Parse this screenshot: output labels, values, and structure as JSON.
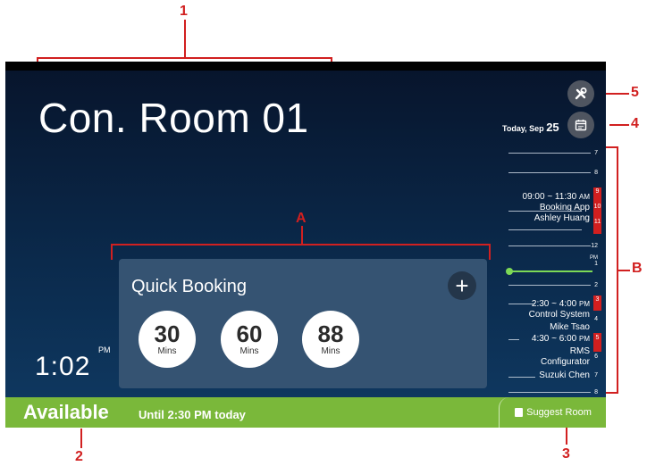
{
  "room": {
    "title": "Con. Room 01"
  },
  "date": {
    "prefix": "Today, Sep",
    "day": "25"
  },
  "timeline": {
    "hours": [
      "7",
      "8",
      "9",
      "10",
      "11",
      "12",
      "1",
      "2",
      "3",
      "4",
      "5",
      "6",
      "7",
      "8"
    ],
    "pm_marker": "PM",
    "booking_1": {
      "time": "09:00 ~ 11:30",
      "ampm": "AM",
      "title": "Booking App",
      "host": "Ashley Huang"
    },
    "booking_2": {
      "time": "2:30 ~ 4:00",
      "ampm": "PM",
      "title": "Control System",
      "host": "Mike Tsao"
    },
    "booking_3": {
      "time": "4:30 ~ 6:00",
      "ampm": "PM",
      "title": "RMS Configurator",
      "host": "Suzuki Chen"
    }
  },
  "quick_booking": {
    "title": "Quick Booking",
    "plus": "+",
    "options": [
      {
        "value": "30",
        "unit": "Mins"
      },
      {
        "value": "60",
        "unit": "Mins"
      },
      {
        "value": "88",
        "unit": "Mins"
      }
    ]
  },
  "clock": {
    "time": "1:02",
    "ampm": "PM"
  },
  "status": {
    "label": "Available",
    "detail": "Until 2:30 PM today"
  },
  "suggest": {
    "label": "Suggest Room"
  },
  "annotations": {
    "n1": "1",
    "n2": "2",
    "n3": "3",
    "n4": "4",
    "n5": "5",
    "A": "A",
    "B": "B"
  },
  "colors": {
    "available": "#7ab83a",
    "booked": "#d21f1f",
    "now_line": "#7dd956",
    "annotation": "#d12020"
  }
}
